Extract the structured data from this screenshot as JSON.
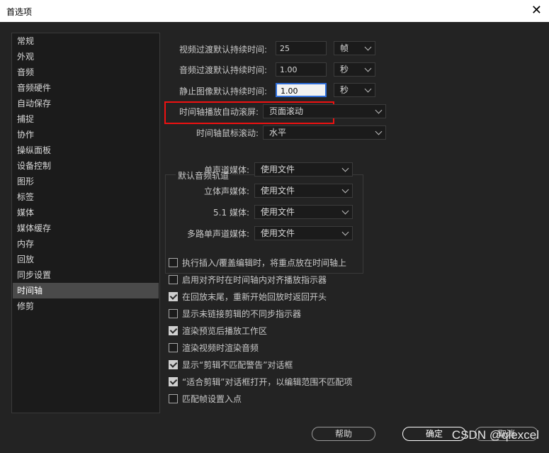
{
  "window": {
    "title": "首选项",
    "close_glyph": "✕"
  },
  "sidebar": {
    "items": [
      {
        "label": "常规"
      },
      {
        "label": "外观"
      },
      {
        "label": "音频"
      },
      {
        "label": "音频硬件"
      },
      {
        "label": "自动保存"
      },
      {
        "label": "捕捉"
      },
      {
        "label": "协作"
      },
      {
        "label": "操纵面板"
      },
      {
        "label": "设备控制"
      },
      {
        "label": "图形"
      },
      {
        "label": "标签"
      },
      {
        "label": "媒体"
      },
      {
        "label": "媒体缓存"
      },
      {
        "label": "内存"
      },
      {
        "label": "回放"
      },
      {
        "label": "同步设置"
      },
      {
        "label": "时间轴"
      },
      {
        "label": "修剪"
      }
    ],
    "selected": "时间轴"
  },
  "settings": {
    "video_transition": {
      "label": "视频过渡默认持续时间:",
      "value": "25",
      "unit": "帧"
    },
    "audio_transition": {
      "label": "音频过渡默认持续时间:",
      "value": "1.00",
      "unit": "秒"
    },
    "still_image": {
      "label": "静止图像默认持续时间:",
      "value": "1.00",
      "unit": "秒"
    },
    "autoscroll": {
      "label": "时间轴播放自动滚屏:",
      "value": "页面滚动"
    },
    "mouse_scroll": {
      "label": "时间轴鼠标滚动:",
      "value": "水平"
    }
  },
  "audio_tracks": {
    "title": "默认音频轨道",
    "rows": [
      {
        "label": "单声道媒体:",
        "value": "使用文件"
      },
      {
        "label": "立体声媒体:",
        "value": "使用文件"
      },
      {
        "label": "5.1 媒体:",
        "value": "使用文件"
      },
      {
        "label": "多路单声道媒体:",
        "value": "使用文件"
      }
    ]
  },
  "checkboxes": [
    {
      "label": "执行插入/覆盖编辑时，将重点放在时间轴上",
      "checked": false
    },
    {
      "label": "启用对齐时在时间轴内对齐播放指示器",
      "checked": false
    },
    {
      "label": "在回放末尾，重新开始回放时返回开头",
      "checked": true
    },
    {
      "label": "显示未链接剪辑的不同步指示器",
      "checked": false
    },
    {
      "label": "渲染预览后播放工作区",
      "checked": true
    },
    {
      "label": "渲染视频时渲染音频",
      "checked": false
    },
    {
      "label": "显示“剪辑不匹配警告”对话框",
      "checked": true
    },
    {
      "label": "“适合剪辑”对话框打开，以编辑范围不匹配项",
      "checked": true
    },
    {
      "label": "匹配帧设置入点",
      "checked": false
    }
  ],
  "buttons": {
    "help": "帮助",
    "ok": "确定",
    "cancel": "取消"
  },
  "watermark": "CSDN @qlexcel",
  "colors": {
    "highlight_border": "#e11111",
    "focus_border": "#2f6fdb",
    "selected_item": "#4a4a4a"
  }
}
